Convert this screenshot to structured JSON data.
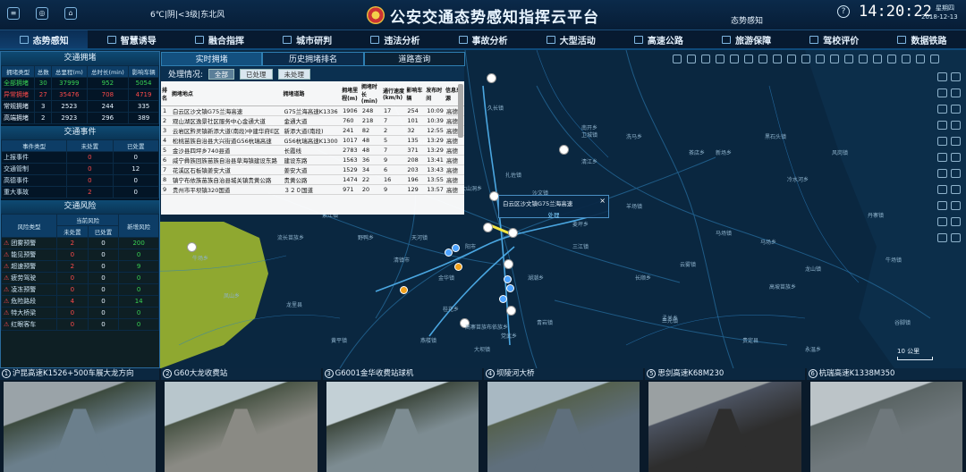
{
  "header": {
    "weather": "6℃|阴|<3级|东北风",
    "title": "公安交通态势感知指挥云平台",
    "subtitle": "态势感知",
    "time": "14:20:22",
    "weekday": "星期四",
    "date": "2018-12-13"
  },
  "nav": [
    {
      "label": "态势感知",
      "active": true
    },
    {
      "label": "智慧诱导"
    },
    {
      "label": "融合指挥"
    },
    {
      "label": "城市研判"
    },
    {
      "label": "违法分析"
    },
    {
      "label": "事故分析"
    },
    {
      "label": "大型活动"
    },
    {
      "label": "高速公路"
    },
    {
      "label": "旅游保障"
    },
    {
      "label": "驾校评价"
    },
    {
      "label": "数据铁路"
    }
  ],
  "left": {
    "congestion": {
      "title": "交通拥堵",
      "headers": [
        "拥堵类型",
        "总数",
        "总里程(m)",
        "总时长(min)",
        "影响车辆"
      ],
      "rows": [
        {
          "name": "全部拥堵",
          "color": "green",
          "cells": [
            "30",
            "37999",
            "952",
            "5054"
          ]
        },
        {
          "name": "异常拥堵",
          "color": "red",
          "cells": [
            "27",
            "35476",
            "708",
            "4719"
          ]
        },
        {
          "name": "常规拥堵",
          "color": "white",
          "cells": [
            "3",
            "2523",
            "244",
            "335"
          ]
        },
        {
          "name": "高端拥堵",
          "color": "white",
          "cells": [
            "2",
            "2923",
            "296",
            "389"
          ]
        }
      ]
    },
    "events": {
      "title": "交通事件",
      "headers": [
        "事件类型",
        "未处置",
        "已处置"
      ],
      "rows": [
        {
          "name": "上报事件",
          "cells": [
            "0",
            "0"
          ]
        },
        {
          "name": "交通管制",
          "cells": [
            "0",
            "12"
          ]
        },
        {
          "name": "高德事件",
          "cells": [
            "0",
            "0"
          ]
        },
        {
          "name": "重大事故",
          "cells": [
            "2",
            "0"
          ]
        }
      ]
    },
    "risk": {
      "title": "交通风险",
      "headers": [
        "风险类型",
        "当前风险",
        "新增风险"
      ],
      "subheaders": [
        "未处置",
        "已处置"
      ],
      "rows": [
        {
          "name": "团雾预警",
          "cells": [
            "2",
            "0",
            "200"
          ]
        },
        {
          "name": "能见预警",
          "cells": [
            "0",
            "0",
            "0"
          ]
        },
        {
          "name": "超速预警",
          "cells": [
            "2",
            "0",
            "9"
          ]
        },
        {
          "name": "疲劳驾驶",
          "cells": [
            "0",
            "0",
            "0"
          ]
        },
        {
          "name": "凌冻预警",
          "cells": [
            "0",
            "0",
            "0"
          ]
        },
        {
          "name": "危险路段",
          "cells": [
            "4",
            "0",
            "14"
          ]
        },
        {
          "name": "特大桥梁",
          "cells": [
            "0",
            "0",
            "0"
          ]
        },
        {
          "name": "红眼客车",
          "cells": [
            "0",
            "0",
            "0"
          ]
        }
      ]
    }
  },
  "tabs": [
    "实时拥堵",
    "历史拥堵排名",
    "道路查询"
  ],
  "filter": {
    "label": "处理情况:",
    "options": [
      "全部",
      "已处理",
      "未处理"
    ]
  },
  "jam_table": {
    "headers": [
      "排名",
      "拥堵地点",
      "拥堵道路",
      "拥堵里程(m)",
      "拥堵时长(min)",
      "通行速度(km/h)",
      "影响车辆",
      "发布时间",
      "信息来源"
    ],
    "rows": [
      [
        "1",
        "白云区沙文镇G75兰海高速",
        "G75兰海高速K1336",
        "1906",
        "248",
        "17",
        "254",
        "10:09",
        "高德"
      ],
      [
        "2",
        "观山湖区逸景社区服务中心金通大道",
        "金通大道",
        "760",
        "218",
        "7",
        "101",
        "10:39",
        "高德"
      ],
      [
        "3",
        "云岩区黔灵镇新添大道(南段)中建华府E区",
        "新添大道(南段)",
        "241",
        "82",
        "2",
        "32",
        "12:55",
        "高德"
      ],
      [
        "4",
        "松桃苗族自治县大兴街道G56杭瑞高速",
        "G56杭瑞高速K1300",
        "1017",
        "48",
        "5",
        "135",
        "13:29",
        "高德"
      ],
      [
        "5",
        "金沙县四坪乡740县道",
        "长霞线",
        "2783",
        "48",
        "7",
        "371",
        "13:29",
        "高德"
      ],
      [
        "6",
        "威宁彝族回族苗族自治县草海镇建设东路",
        "建设东路",
        "1563",
        "36",
        "9",
        "208",
        "13:41",
        "高德"
      ],
      [
        "7",
        "花溪区石板镇姜安大道",
        "姜安大道",
        "1529",
        "34",
        "6",
        "203",
        "13:43",
        "高德"
      ],
      [
        "8",
        "镇宁布依族苗族自治县城关镇贵黄公路",
        "贵黄公路",
        "1474",
        "22",
        "16",
        "196",
        "13:55",
        "高德"
      ],
      [
        "9",
        "贵州市平坝镇320国道",
        "３２０国道",
        "971",
        "20",
        "9",
        "129",
        "13:57",
        "高德"
      ]
    ]
  },
  "popup": {
    "title": "白云区沙文镇G75兰海高速",
    "action": "处理",
    "close": "×"
  },
  "map_labels": [
    "久长镇",
    "毛岗镇",
    "大山洞乡",
    "南开乡",
    "洗马乡",
    "清江乡",
    "黑石头镇",
    "新场乡",
    "扎佐镇",
    "沙文镇",
    "紫江镇",
    "牛场乡",
    "流长苗族乡",
    "野鸭乡",
    "天河镇",
    "清镇市",
    "金华镇",
    "阳市",
    "湖潮乡",
    "马场镇",
    "三江镇",
    "麦坪乡",
    "卫城镇",
    "高寨苗族布依族乡",
    "党武乡",
    "青岩镇",
    "桂花乡",
    "黄平镇",
    "燕楼镇",
    "高坡苗族乡",
    "孟关乡",
    "长顺乡",
    "云雾镇",
    "三元镇",
    "马场乡",
    "龙山镇",
    "大坝镇",
    "羊场镇",
    "茶店乡",
    "冷水河乡",
    "风岗镇",
    "丹寨镇",
    "牛场镇",
    "谷脚镇",
    "永温乡",
    "贵定县",
    "凤山乡",
    "龙里县"
  ],
  "scale": "10 公里",
  "cameras": [
    {
      "num": "1",
      "title": "沪昆高速K1526+500车展大龙方向"
    },
    {
      "num": "2",
      "title": "G60大龙收费站"
    },
    {
      "num": "3",
      "title": "G6001金华收费站球机"
    },
    {
      "num": "4",
      "title": "坝陵河大桥"
    },
    {
      "num": "5",
      "title": "思剑高速K68M230"
    },
    {
      "num": "6",
      "title": "杭瑞高速K1338M350"
    }
  ],
  "colors": {
    "red": "#ff4a4a",
    "green": "#39d353",
    "accent": "#2f7fb2"
  }
}
